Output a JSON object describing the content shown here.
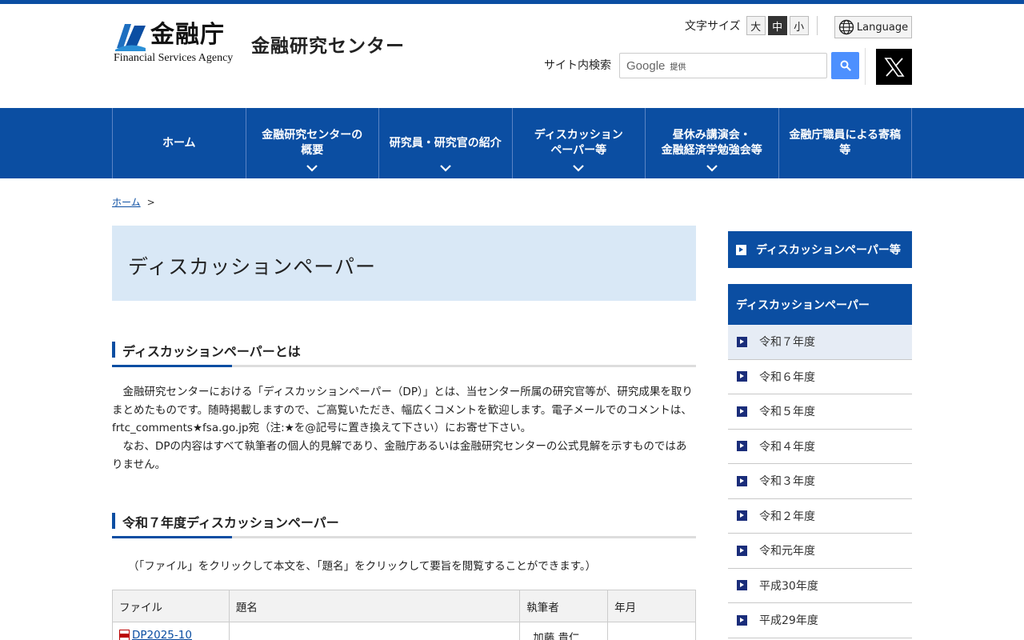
{
  "header": {
    "logo_jp": "金融庁",
    "logo_en": "Financial Services Agency",
    "site_title": "金融研究センター",
    "fontsize_label": "文字サイズ",
    "fontsize_options": [
      "大",
      "中",
      "小"
    ],
    "language_label": "Language",
    "search_label": "サイト内検索",
    "search_brand": "Google",
    "search_brand_sub": "提供",
    "search_icon": "search-icon",
    "social_icon": "x-logo-icon"
  },
  "nav": {
    "items": [
      "ホーム",
      "金融研究センターの\n概要",
      "研究員・研究官の紹介",
      "ディスカッション\nペーパー等",
      "昼休み講演会・\n金融経済学勉強会等",
      "金融庁職員による寄稿\n等"
    ]
  },
  "breadcrumb": {
    "home": "ホーム",
    "sep": ">"
  },
  "main": {
    "page_title": "ディスカッションペーパー",
    "section1_title": "ディスカッションペーパーとは",
    "section1_p1": "金融研究センターにおける「ディスカッションペーパー（DP）」とは、当センター所属の研究官等が、研究成果を取りまとめたものです。随時掲載しますので、ご高覧いただき、幅広くコメントを歓迎します。電子メールでのコメントは、frtc_comments★fsa.go.jp宛（注:★を@記号に置き換えて下さい）にお寄せ下さい。",
    "section1_p2": "なお、DPの内容はすべて執筆者の個人的見解であり、金融庁あるいは金融研究センターの公式見解を示すものではありません。",
    "section2_title": "令和７年度ディスカッションペーパー",
    "section2_note": "（「ファイル」をクリックして本文を、「題名」をクリックして要旨を閲覧することができます。）",
    "table": {
      "headers": [
        "ファイル",
        "題名",
        "執筆者",
        "年月"
      ],
      "rows": [
        {
          "file": "DP2025-10",
          "title": "",
          "author": "加藤 貴仁",
          "date": ""
        }
      ]
    }
  },
  "sidebar": {
    "head1": "ディスカッションペーパー等",
    "head2": "ディスカッションペーパー",
    "items": [
      "令和７年度",
      "令和６年度",
      "令和５年度",
      "令和４年度",
      "令和３年度",
      "令和２年度",
      "令和元年度",
      "平成30年度",
      "平成29年度"
    ]
  },
  "colors": {
    "brand_blue": "#0b4ea2",
    "title_bg": "#d9e8f6",
    "sidebar_marker": "#1a2d7a"
  }
}
